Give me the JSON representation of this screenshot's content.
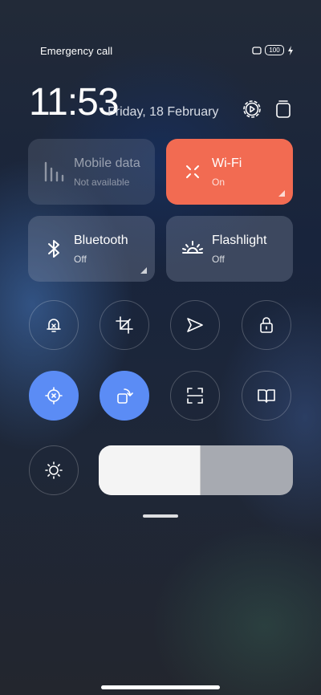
{
  "status": {
    "left_text": "Emergency call",
    "battery": "100"
  },
  "header": {
    "time": "11:53",
    "date": "Friday, 18 February"
  },
  "tiles": [
    {
      "name": "Mobile data",
      "status": "Not available",
      "icon": "signal-bars-icon",
      "state": "disabled"
    },
    {
      "name": "Wi-Fi",
      "status": "On",
      "icon": "wifi-icon",
      "state": "active"
    },
    {
      "name": "Bluetooth",
      "status": "Off",
      "icon": "bluetooth-icon",
      "state": "inactive"
    },
    {
      "name": "Flashlight",
      "status": "Off",
      "icon": "flashlight-icon",
      "state": "inactive"
    }
  ],
  "toggles": [
    {
      "icon": "mute-bell-icon",
      "on": false
    },
    {
      "icon": "screenshot-crop-icon",
      "on": false
    },
    {
      "icon": "airplane-mode-icon",
      "on": false
    },
    {
      "icon": "lock-screen-icon",
      "on": false
    },
    {
      "icon": "location-icon",
      "on": true
    },
    {
      "icon": "auto-rotate-icon",
      "on": true
    },
    {
      "icon": "scanner-icon",
      "on": false
    },
    {
      "icon": "reading-mode-icon",
      "on": false
    }
  ],
  "brightness": {
    "level_percent": 52,
    "icon": "brightness-sun-icon"
  },
  "colors": {
    "active_tile": "#f26b52",
    "active_toggle": "#5b8cf5"
  }
}
